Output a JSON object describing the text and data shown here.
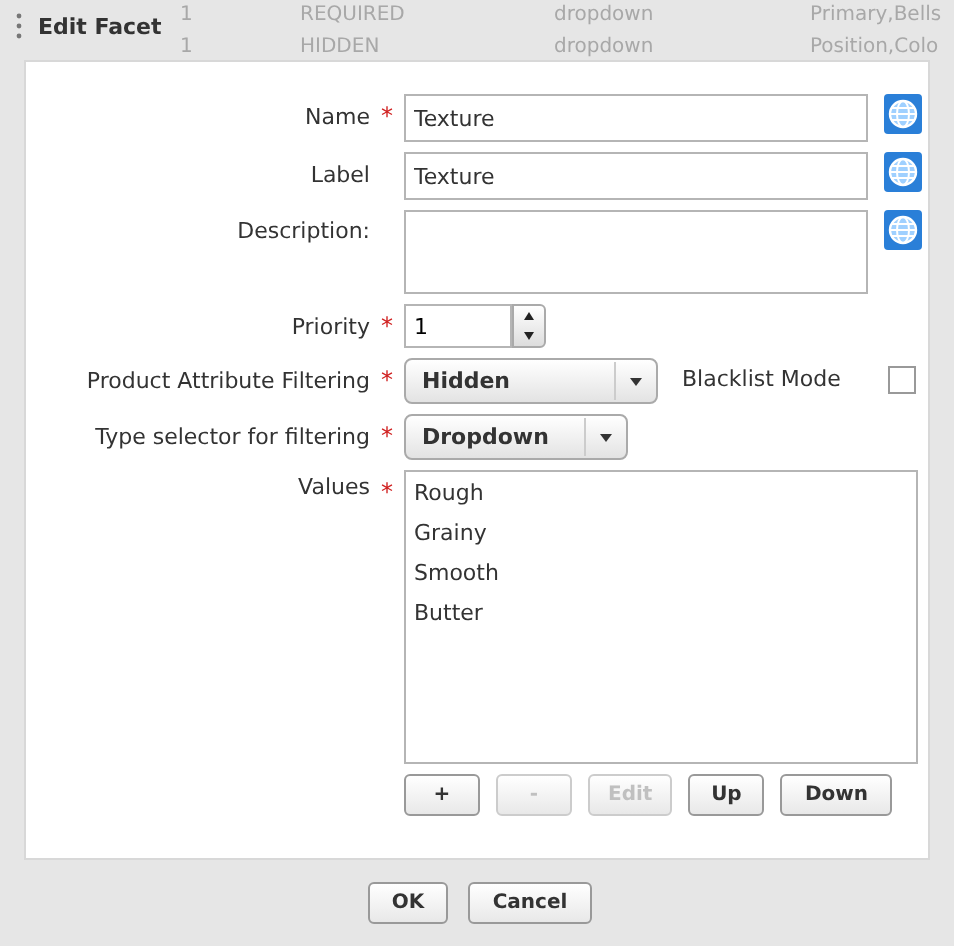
{
  "background_rows": [
    [
      "1",
      "REQUIRED",
      "dropdown",
      "Primary,Bells"
    ],
    [
      "1",
      "HIDDEN",
      "dropdown",
      "Position,Colo"
    ]
  ],
  "dialog": {
    "title": "Edit Facet"
  },
  "fields": [
    {
      "kind": "text",
      "label": "Name",
      "required_mark": "*",
      "value": "Texture",
      "translatable": true
    },
    {
      "kind": "text",
      "label": "Label",
      "value": "Texture",
      "translatable": true
    },
    {
      "kind": "textarea",
      "label": "Description:",
      "translatable": true
    },
    {
      "kind": "spinner",
      "label": "Priority",
      "required_mark": "*",
      "value": "1",
      "translatable": false
    }
  ],
  "filtering": {
    "label": "Product Attribute Filtering",
    "required_mark": "*",
    "value": "Hidden",
    "blacklist_label": "Blacklist Mode",
    "blacklist_checked": false
  },
  "type_selector": {
    "label": "Type selector for filtering",
    "required_mark": "*",
    "value": "Dropdown"
  },
  "values": {
    "label": "Values",
    "required_mark": "*",
    "items": [
      "Rough",
      "Grainy",
      "Smooth",
      "Butter"
    ]
  },
  "list_buttons": [
    {
      "label": "+",
      "disabled": false
    },
    {
      "label": "-",
      "disabled": true
    },
    {
      "label": "Edit",
      "disabled": true
    },
    {
      "label": "Up",
      "disabled": false
    },
    {
      "label": "Down",
      "disabled": false
    }
  ],
  "footer_buttons": [
    "OK",
    "Cancel"
  ]
}
